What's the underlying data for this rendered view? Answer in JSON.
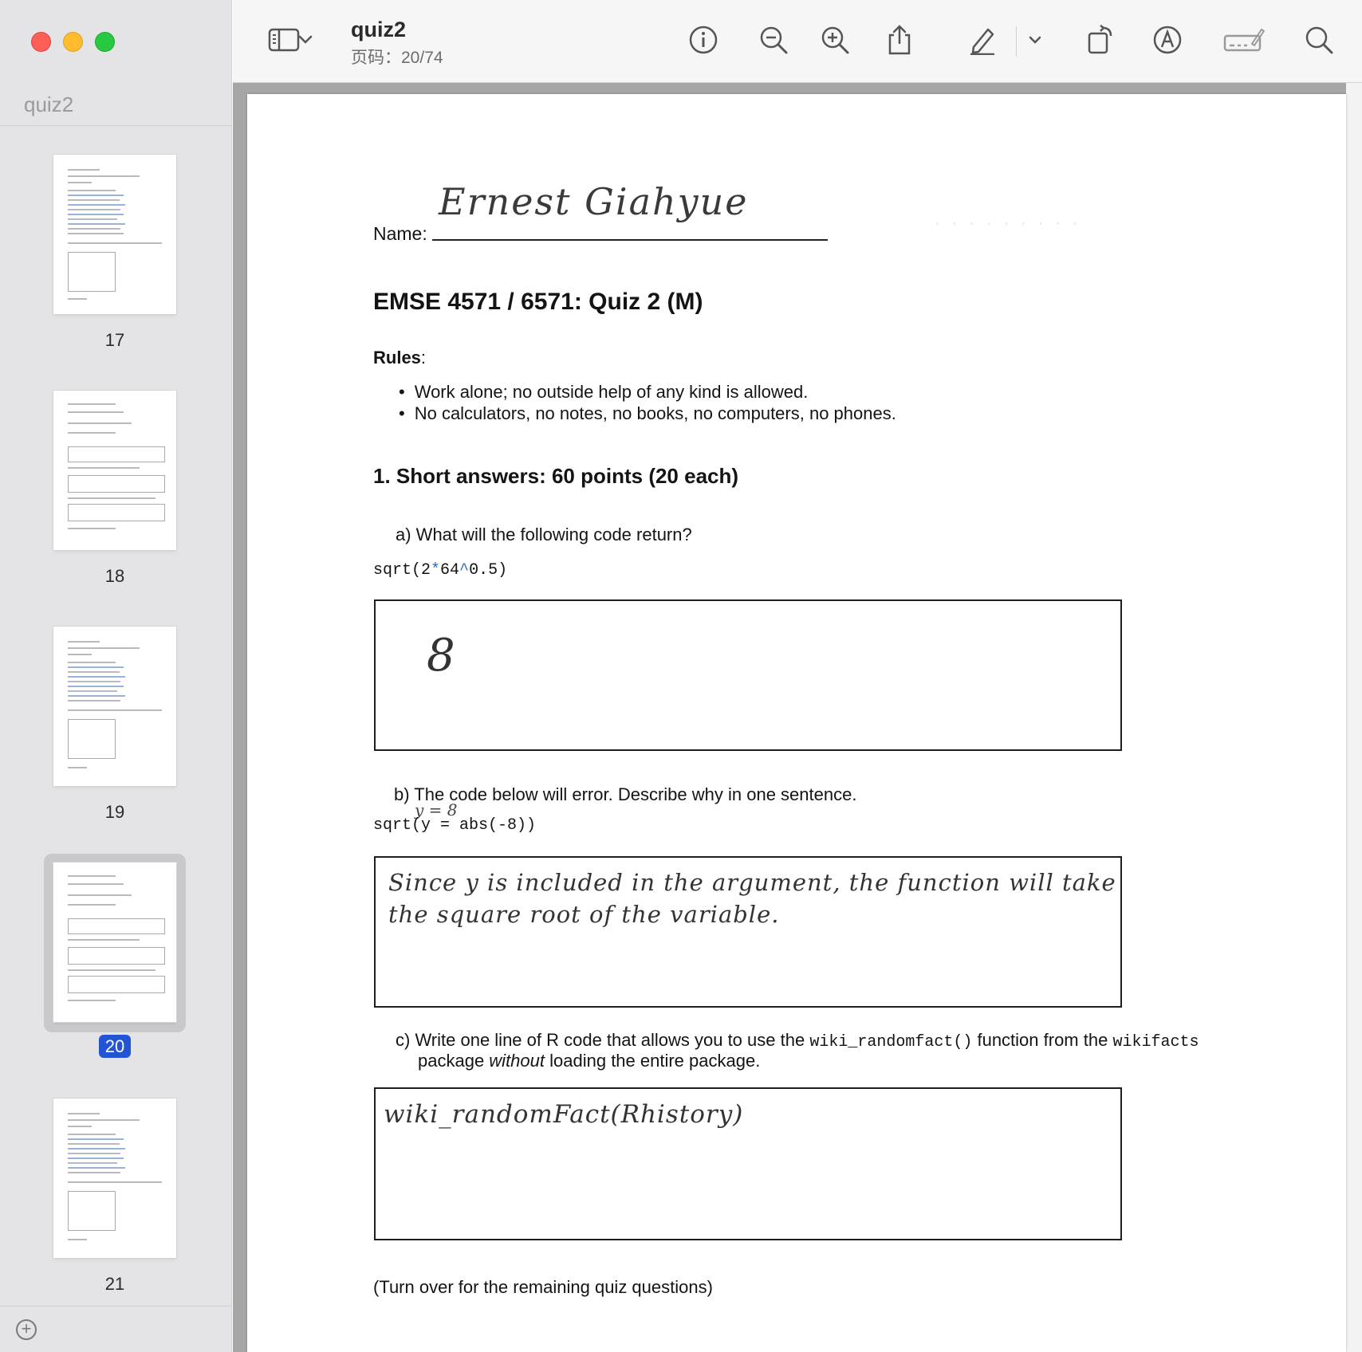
{
  "window": {
    "sidebar_title": "quiz2",
    "doc_title": "quiz2",
    "page_indicator": "页码：20/74"
  },
  "toolbar": {
    "icons": [
      "sidebar-toggle-icon",
      "chevron-down-icon",
      "info-icon",
      "zoom-out-icon",
      "zoom-in-icon",
      "share-icon",
      "markup-pen-icon",
      "chevron-down-icon",
      "rotate-icon",
      "annotate-icon",
      "signature-icon",
      "search-icon"
    ]
  },
  "thumbnails": [
    {
      "page": "17",
      "selected": false
    },
    {
      "page": "18",
      "selected": false
    },
    {
      "page": "19",
      "selected": false
    },
    {
      "page": "20",
      "selected": true
    },
    {
      "page": "21",
      "selected": false
    }
  ],
  "document": {
    "name_label": "Name:",
    "name_value": "Ernest Giahyue",
    "title": "EMSE 4571 / 6571: Quiz 2 (M)",
    "rules_label": "Rules",
    "rules_colon": ":",
    "rules": [
      "Work alone; no outside help of any kind is allowed.",
      "No calculators, no notes, no books, no computers, no phones."
    ],
    "section_title": "1. Short answers: 60 points (20 each)",
    "q_a": {
      "label": "a)  What will the following code return?",
      "code_pre": "sqrt(2",
      "code_op1": "*",
      "code_mid": "64",
      "code_op2": "^",
      "code_post": "0.5)",
      "answer": "8"
    },
    "q_b": {
      "label": "b)  The code below will error. Describe why in one sentence.",
      "code": "sqrt(y = abs(-8))",
      "margin_note": "y = 8",
      "answer_line1": "Since  y is included in the argument, the function will take",
      "answer_line2": "the square root of the variable."
    },
    "q_c": {
      "label_pre": "c)  Write one line of R code that allows you to use the ",
      "fn": "wiki_randomfact()",
      "label_mid": " function from the ",
      "pkg": "wikifacts",
      "label_line2_pre": "package ",
      "label_line2_em": "without",
      "label_line2_post": " loading the entire package.",
      "answer": "wiki_randomFact(Rhistory)"
    },
    "footer": "(Turn over for the remaining quiz questions)"
  }
}
